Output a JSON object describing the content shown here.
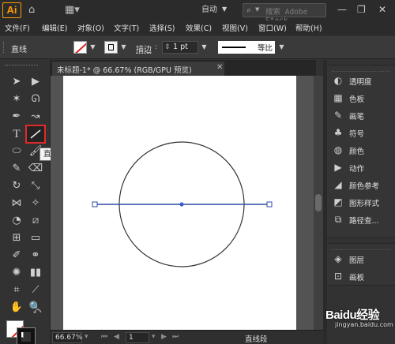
{
  "app": {
    "logo": "Ai"
  },
  "titlebar": {
    "workspace": "自动",
    "search_placeholder": "搜索 Adobe Stock"
  },
  "menubar": {
    "items": [
      "文件(F)",
      "编辑(E)",
      "对象(O)",
      "文字(T)",
      "选择(S)",
      "效果(C)",
      "视图(V)",
      "窗口(W)",
      "帮助(H)"
    ]
  },
  "controlbar": {
    "object_type": "直线",
    "stroke_label": "描边",
    "stroke_weight": "1 pt",
    "profile_label": "等比"
  },
  "document": {
    "tab_title": "未标题-1* @ 66.67% (RGB/GPU 预览)"
  },
  "tooltip": {
    "text": "直线段工具 (\\)"
  },
  "status": {
    "zoom": "66.67%",
    "page": "1",
    "current_tool": "直线段"
  },
  "panels": {
    "group1": [
      {
        "icon": "transparency-icon",
        "label": "透明度"
      },
      {
        "icon": "swatches-icon",
        "label": "色板"
      },
      {
        "icon": "brush-icon",
        "label": "画笔"
      },
      {
        "icon": "symbol-icon",
        "label": "符号"
      },
      {
        "icon": "color-icon",
        "label": "颜色"
      },
      {
        "icon": "play-icon",
        "label": "动作"
      },
      {
        "icon": "color-guide-icon",
        "label": "颜色参考"
      },
      {
        "icon": "graphic-styles-icon",
        "label": "图形样式"
      },
      {
        "icon": "pathfinder-icon",
        "label": "路径查..."
      }
    ],
    "group2": [
      {
        "icon": "layers-icon",
        "label": "图层"
      },
      {
        "icon": "artboards-icon",
        "label": "画板"
      }
    ]
  },
  "watermark": {
    "text": "Baidu经验",
    "sub": "jingyan.baidu.com"
  },
  "colors": {
    "ui_dark": "#323232",
    "selection_blue": "#2f4aa6",
    "highlight_red": "#e02a2a"
  }
}
